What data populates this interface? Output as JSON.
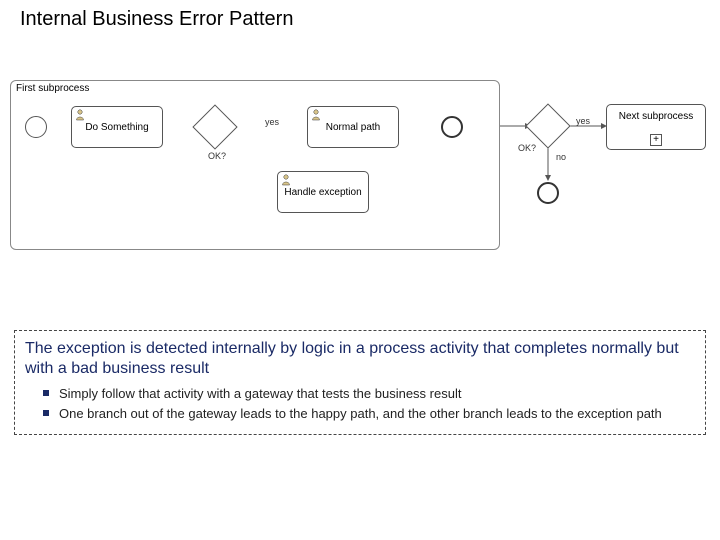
{
  "title": "Internal Business Error Pattern",
  "diagram": {
    "subprocess_label": "First subprocess",
    "tasks": {
      "do_something": "Do Something",
      "normal_path": "Normal path",
      "handle_exception": "Handle exception",
      "next_subprocess": "Next subprocess"
    },
    "gateway1_label": "OK?",
    "gateway2_label": "OK?",
    "edges": {
      "gw1_yes": "yes",
      "gw2_yes": "yes",
      "gw2_no": "no"
    },
    "plus_marker": "+"
  },
  "description": {
    "main": "The exception is detected internally by logic in a process activity that completes normally but with a bad business result",
    "bullets": [
      "Simply follow that activity with a gateway that tests the business result",
      "One branch out of the gateway leads to the happy path, and the other branch leads to the exception path"
    ]
  }
}
